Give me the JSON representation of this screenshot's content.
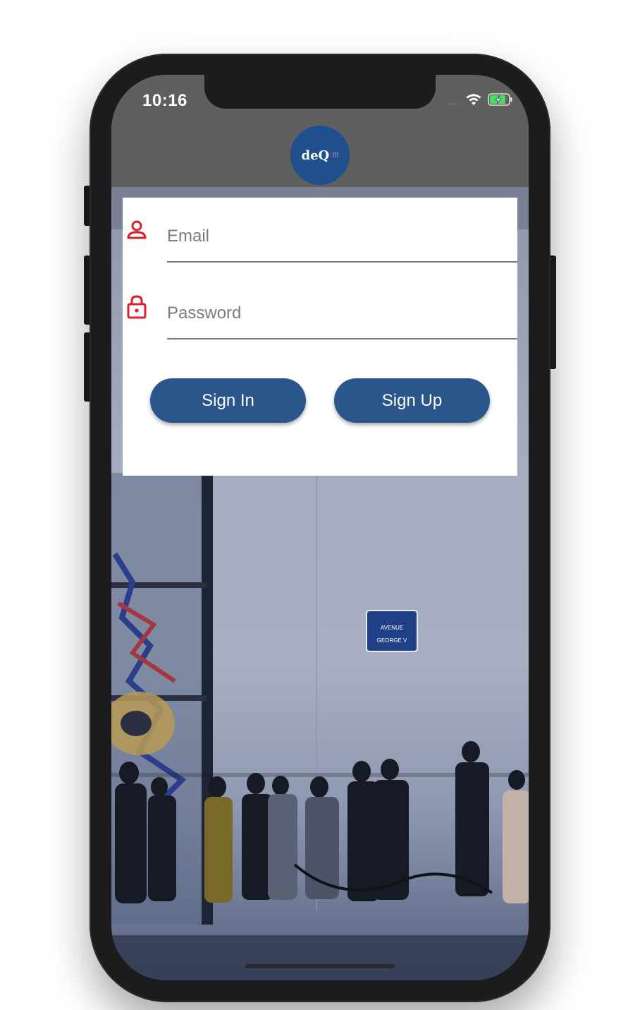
{
  "status_bar": {
    "time": "10:16",
    "signal_dots": "....",
    "wifi_icon": "wifi-icon",
    "battery_icon": "battery-charging-icon"
  },
  "header": {
    "logo_text": "deQ",
    "logo_accent": "!",
    "logo_dots": "⁞⁞⁞",
    "logo_color": "#1f4f8d"
  },
  "login_form": {
    "email": {
      "placeholder": "Email",
      "value": "",
      "icon": "user-icon"
    },
    "password": {
      "placeholder": "Password",
      "value": "",
      "icon": "lock-icon"
    },
    "sign_in_label": "Sign In",
    "sign_up_label": "Sign Up",
    "button_color": "#2a568b",
    "icon_color": "#d9202a"
  },
  "background": {
    "street_sign_line1": "AVENUE",
    "street_sign_line2": "GEORGE    V"
  }
}
